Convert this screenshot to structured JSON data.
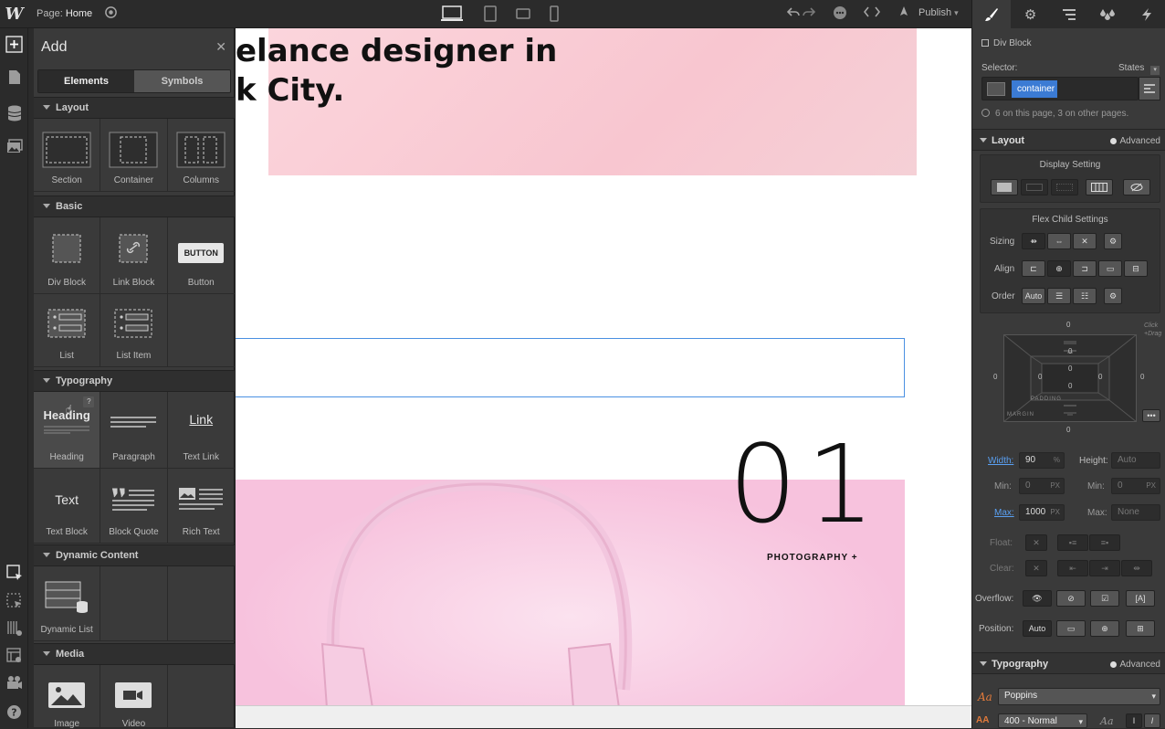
{
  "topbar": {
    "logo": "W",
    "page_prefix": "Page:",
    "page_name": "Home",
    "publish_label": "Publish"
  },
  "add_panel": {
    "title": "Add",
    "tabs": [
      {
        "label": "Elements",
        "active": true
      },
      {
        "label": "Symbols",
        "active": false
      }
    ],
    "sections": {
      "layout": {
        "title": "Layout",
        "items": [
          "Section",
          "Container",
          "Columns"
        ]
      },
      "basic": {
        "title": "Basic",
        "items": [
          "Div Block",
          "Link Block",
          "Button",
          "List",
          "List Item"
        ],
        "button_glyph": "BUTTON"
      },
      "typography": {
        "title": "Typography",
        "items": [
          "Heading",
          "Paragraph",
          "Text Link",
          "Text Block",
          "Block Quote",
          "Rich Text"
        ],
        "heading_glyph": "Heading",
        "link_glyph": "Link",
        "text_glyph": "Text",
        "help_glyph": "?"
      },
      "dynamic": {
        "title": "Dynamic Content",
        "items": [
          "Dynamic List"
        ]
      },
      "media": {
        "title": "Media",
        "items": [
          "Image",
          "Video"
        ]
      }
    }
  },
  "canvas": {
    "hero_text": "elance designer in\nk City.",
    "number": "01",
    "photo_label": "PHOTOGRAPHY +"
  },
  "right_panel": {
    "element_type": "Div Block",
    "selector_label": "Selector:",
    "states_label": "States",
    "selector_class": "container",
    "usage_note": "6 on this page, 3 on other pages.",
    "layout": {
      "title": "Layout",
      "advanced": "Advanced",
      "display_setting": "Display Setting",
      "flex_child": "Flex Child Settings",
      "sizing": "Sizing",
      "align": "Align",
      "order": "Order",
      "order_value": "Auto",
      "click_drag_hint": "Click\n+Drag",
      "margin_label": "MARGIN",
      "padding_label": "PADDING",
      "zero": "0"
    },
    "size": {
      "width_label": "Width:",
      "width_value": "90",
      "width_unit": "%",
      "height_label": "Height:",
      "height_value": "Auto",
      "min_label": "Min:",
      "min_w": "0",
      "min_h": "0",
      "px": "PX",
      "max_label": "Max:",
      "max_w": "1000",
      "max_h": "None"
    },
    "float_label": "Float:",
    "clear_label": "Clear:",
    "overflow_label": "Overflow:",
    "position_label": "Position:",
    "position_value": "Auto",
    "typography": {
      "title": "Typography",
      "advanced": "Advanced",
      "font": "Poppins",
      "weight": "400 - Normal",
      "aa": "Aa"
    }
  }
}
